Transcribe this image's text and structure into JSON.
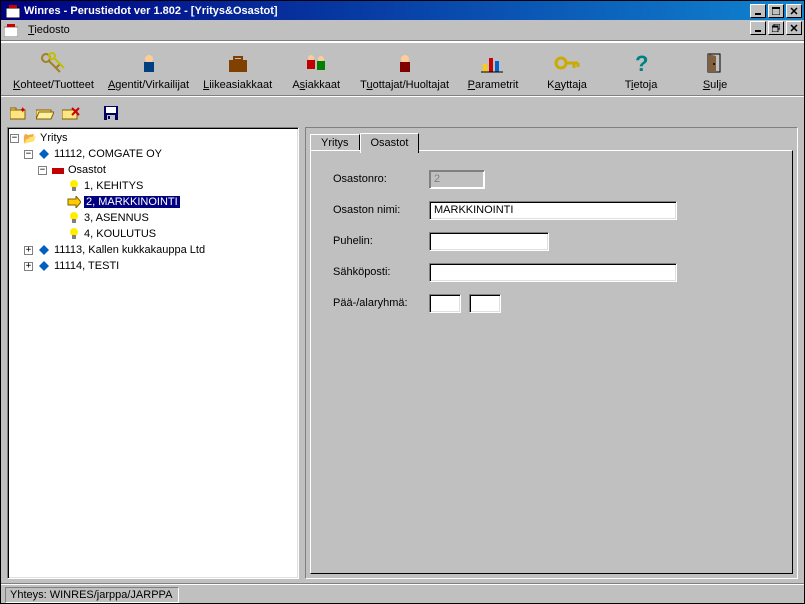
{
  "titlebar": {
    "text": "Winres - Perustiedot ver 1.802 - [Yritys&Osastot]"
  },
  "menubar": {
    "file": "Tiedosto",
    "file_hotkey": "T"
  },
  "toolbar": {
    "items": [
      {
        "label": "Kohteet/Tuotteet",
        "hotkey": "K",
        "icon": "keys"
      },
      {
        "label": "Agentit/Virkailijat",
        "hotkey": "A",
        "icon": "person"
      },
      {
        "label": "Liikeasiakkaat",
        "hotkey": "L",
        "icon": "briefcase"
      },
      {
        "label": "Asiakkaat",
        "hotkey": "s",
        "icon": "people"
      },
      {
        "label": "Tuottajat/Huoltajat",
        "hotkey": "u",
        "icon": "person-red"
      },
      {
        "label": "Parametrit",
        "hotkey": "P",
        "icon": "chart"
      },
      {
        "label": "Kayttaja",
        "hotkey": "a",
        "icon": "key"
      },
      {
        "label": "Tietoja",
        "hotkey": "i",
        "icon": "help"
      },
      {
        "label": "Sulje",
        "hotkey": "S",
        "icon": "door"
      }
    ]
  },
  "iconbar": {
    "icons": [
      "new-folder",
      "open-folder",
      "delete-folder",
      "save"
    ]
  },
  "tree": {
    "root": "Yritys",
    "nodes": [
      {
        "label": "11112, COMGATE OY",
        "icon": "diamond",
        "expanded": true,
        "children_label": "Osastot",
        "children": [
          {
            "label": "1, KEHITYS",
            "icon": "bulb"
          },
          {
            "label": "2, MARKKINOINTI",
            "icon": "point",
            "selected": true
          },
          {
            "label": "3, ASENNUS",
            "icon": "bulb"
          },
          {
            "label": "4, KOULUTUS",
            "icon": "bulb"
          }
        ]
      },
      {
        "label": "11113, Kallen kukkakauppa Ltd",
        "icon": "diamond",
        "expanded": false
      },
      {
        "label": "11114, TESTI",
        "icon": "diamond",
        "expanded": false
      }
    ]
  },
  "tabs": {
    "tab1": "Yritys",
    "tab2": "Osastot",
    "active": 1
  },
  "form": {
    "osastonro_label": "Osastonro:",
    "osastonro_value": "2",
    "osaston_nimi_label": "Osaston nimi:",
    "osaston_nimi_value": "MARKKINOINTI",
    "puhelin_label": "Puhelin:",
    "puhelin_value": "",
    "sahkoposti_label": "Sähköposti:",
    "sahkoposti_value": "",
    "ryhma_label": "Pää-/alaryhmä:",
    "ryhma_value1": "",
    "ryhma_value2": ""
  },
  "statusbar": {
    "text": "Yhteys: WINRES/jarppa/JARPPA"
  }
}
